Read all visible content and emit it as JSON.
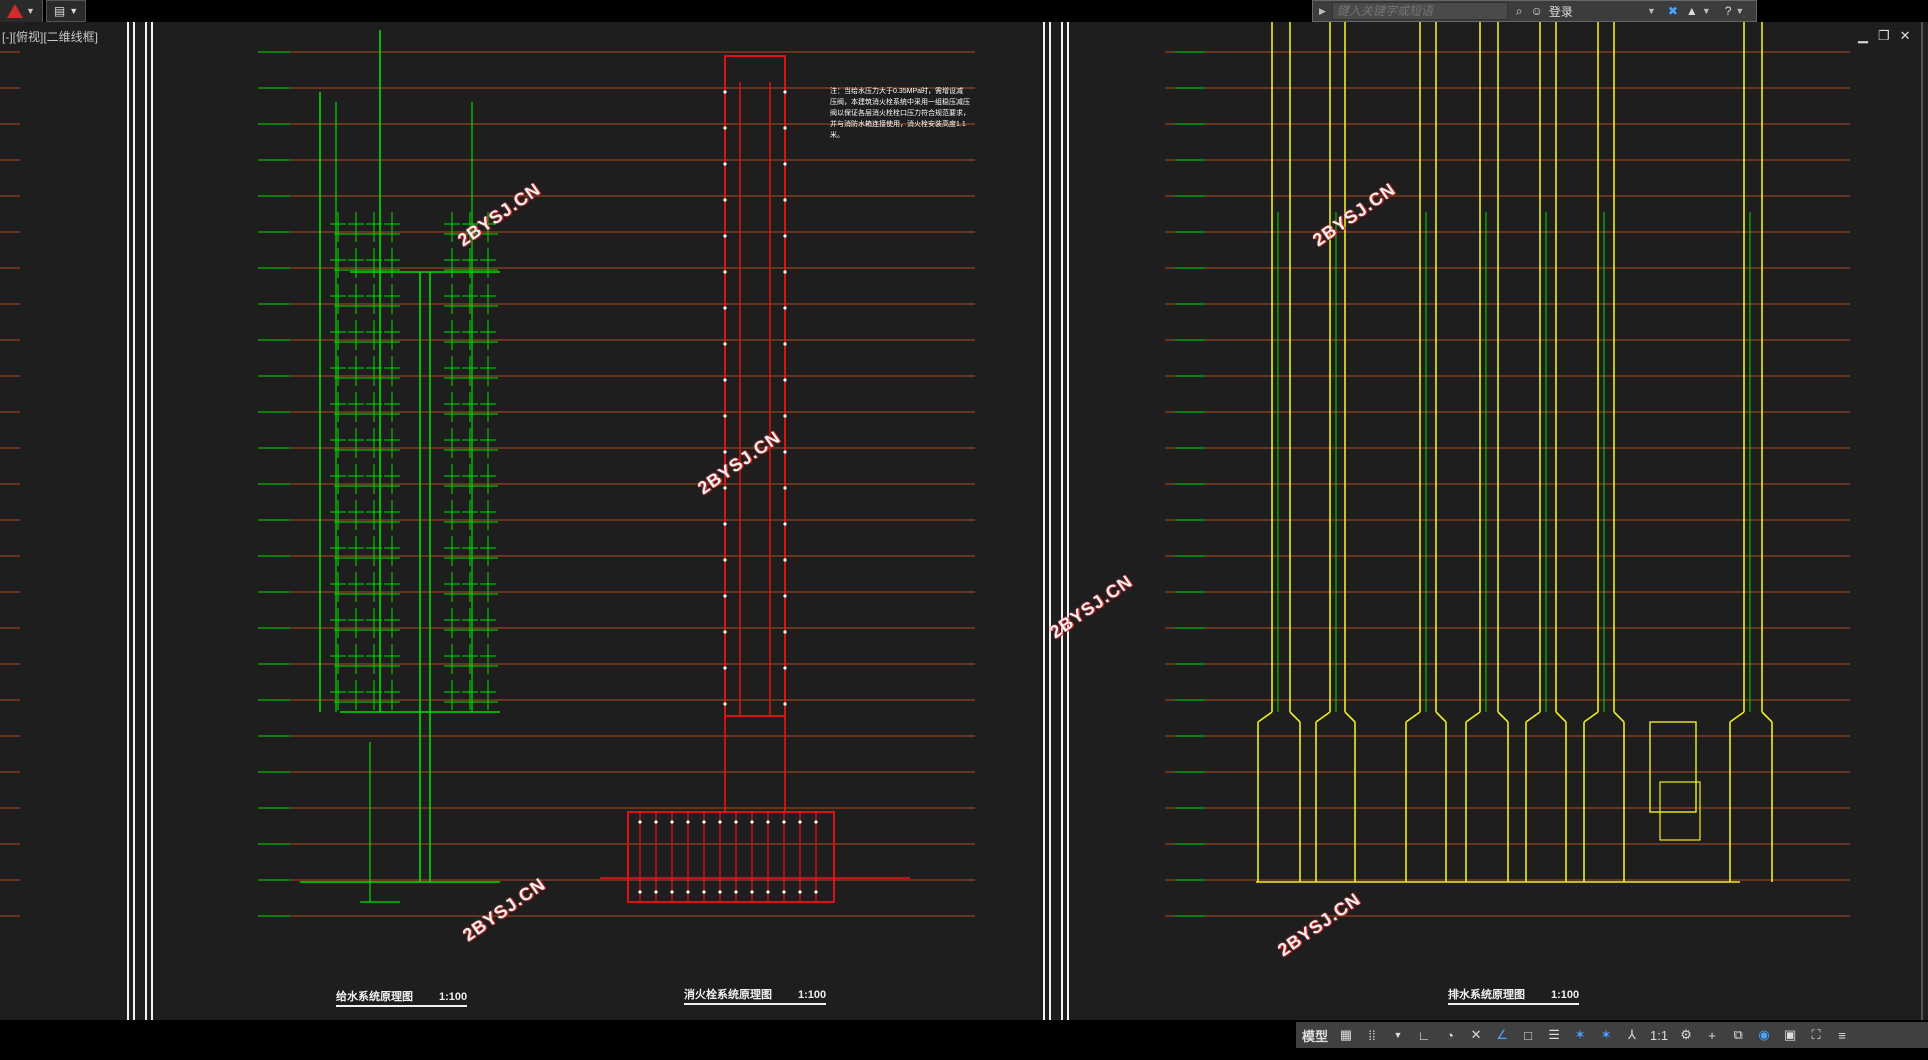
{
  "topbar": {
    "search_placeholder": "键入关键字或短语",
    "login_label": "登录",
    "viewport_label": "[-][俯视][二维线框]"
  },
  "sheets": {
    "water_supply_title": "给水系统原理图",
    "fire_hydrant_title": "消火栓系统原理图",
    "drainage_title": "排水系统原理图",
    "scale": "1:100"
  },
  "note_text": "注：当给水压力大于0.35MPa时，需增设减压阀，本建筑消火栓系统中采用一组稳压减压阀以保证各层消火栓栓口压力符合规范要求，并与消防水箱连接使用，消火栓安装高度1.1米。",
  "watermark_text": "2BYSJ.CN",
  "statusbar": {
    "model_label": "模型",
    "scale_label": "1:1"
  },
  "colors": {
    "background": "#1e1e1e",
    "water_supply": "#00dd00",
    "fire_hydrant": "#ee1111",
    "drainage": "#eeee22",
    "floor_lines": "#b04a1e"
  },
  "icons": [
    "autocad-logo-icon",
    "search-arrow-icon",
    "binoculars-icon",
    "user-icon",
    "exchange-icon",
    "app-store-icon",
    "help-icon",
    "grid-icon",
    "snap-icon",
    "ortho-icon",
    "polar-icon",
    "osnap-icon",
    "lineweight-icon",
    "annotation-icon",
    "workspace-icon",
    "fullscreen-icon",
    "menu-icon"
  ]
}
